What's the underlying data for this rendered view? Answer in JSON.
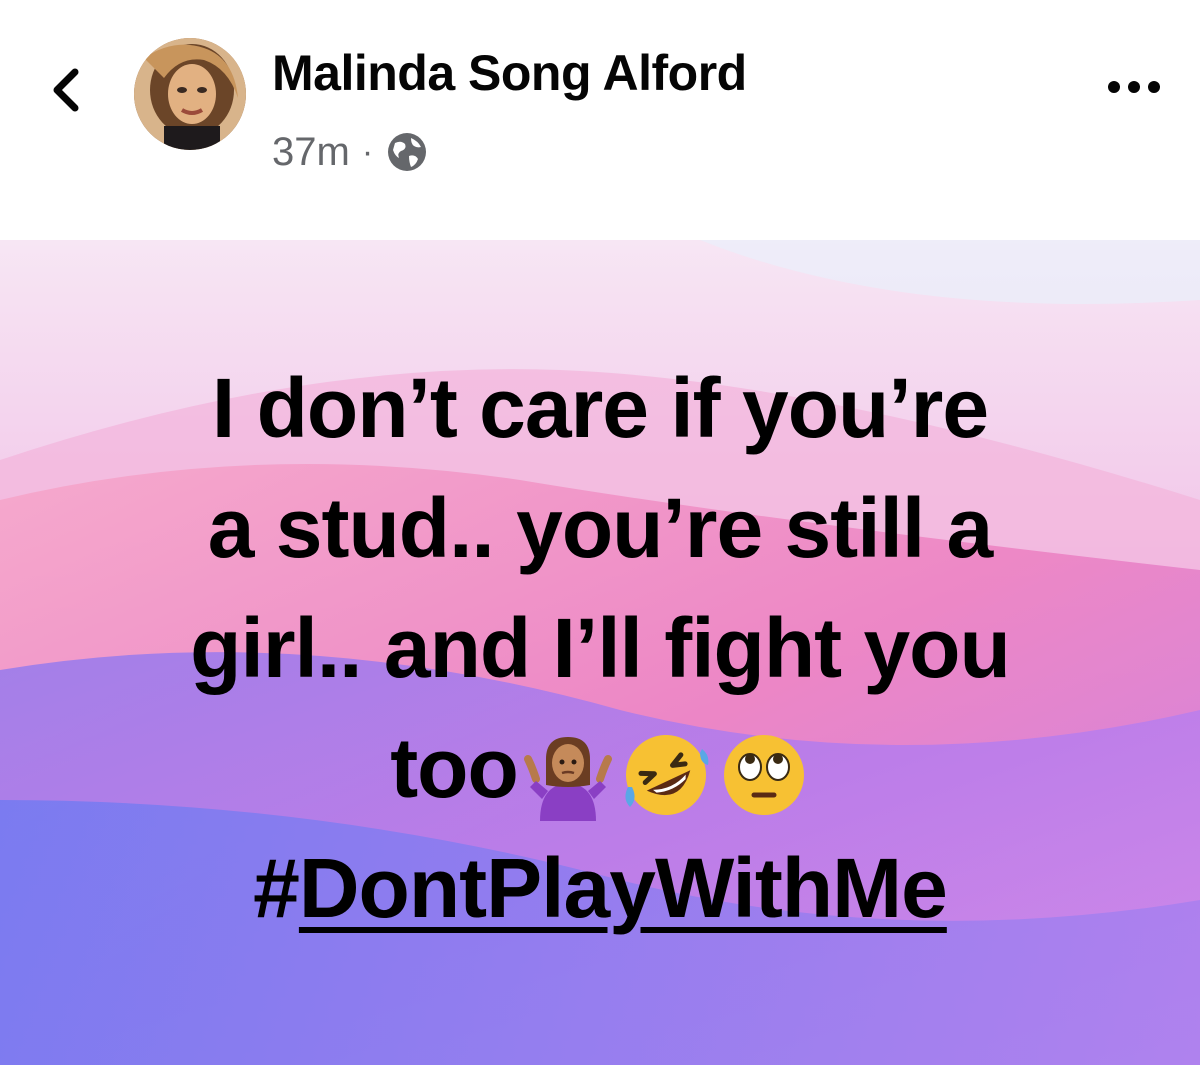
{
  "header": {
    "author_name": "Malinda Song Alford",
    "timestamp": "37m",
    "separator": "·",
    "privacy_icon": "globe-icon",
    "back_icon": "chevron-left-icon",
    "more_icon": "more-horizontal-icon"
  },
  "post": {
    "lines": [
      "I don’t care if you’re",
      "a stud.. you’re still a",
      "girl.. and I’ll fight you",
      "too"
    ],
    "emojis": [
      "person-shrugging-emoji",
      "rolling-on-floor-laughing-emoji",
      "face-with-rolling-eyes-emoji"
    ],
    "hashtag_symbol": "#",
    "hashtag_text": "DontPlayWithMe",
    "colors": {
      "text": "#000000",
      "bg_top": "#f7e6f4",
      "bg_pink": "#ef86c6",
      "bg_purple": "#b07af0",
      "bg_blue": "#6d7cf2"
    }
  }
}
